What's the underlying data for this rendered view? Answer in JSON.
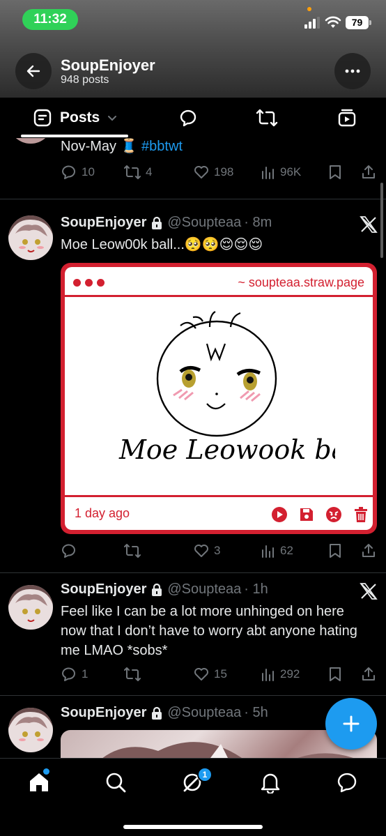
{
  "status_bar": {
    "time": "11:32",
    "battery": "79"
  },
  "header": {
    "name": "SoupEnjoyer",
    "post_count": "948 posts"
  },
  "tabs": {
    "posts_label": "Posts"
  },
  "tweets": [
    {
      "text_prefix": "Nov-May ",
      "emoji": "🧵",
      "hashtag": "#bbtwt",
      "replies": "10",
      "reposts": "4",
      "likes": "198",
      "views": "96K"
    },
    {
      "name": "SoupEnjoyer",
      "handle": "@Soupteaa",
      "time": "· 8m",
      "text": "Moe Leow00k ball...🥺🥺😌😌😌",
      "card": {
        "url": "~ soupteaa.straw.page",
        "timestamp": "1 day ago",
        "drawing_caption": "Moe Leowook ball"
      },
      "replies": "",
      "reposts": "",
      "likes": "3",
      "views": "62"
    },
    {
      "name": "SoupEnjoyer",
      "handle": "@Soupteaa",
      "time": "· 1h",
      "text": "Feel like I can be a lot more unhinged on here now that I don’t have to worry abt anyone hating me LMAO *sobs*",
      "replies": "1",
      "reposts": "",
      "likes": "15",
      "views": "292"
    },
    {
      "name": "SoupEnjoyer",
      "handle": "@Soupteaa",
      "time": "· 5h"
    }
  ],
  "bottom_nav": {
    "grok_badge": "1"
  },
  "colors": {
    "accent": "#1d9bf0",
    "card_red": "#d32030",
    "status_green": "#30d158"
  }
}
